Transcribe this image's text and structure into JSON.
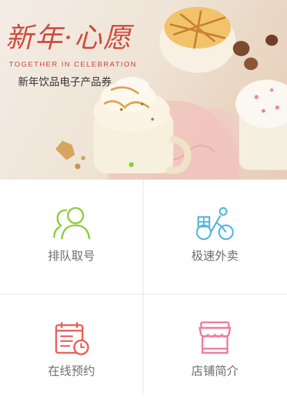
{
  "banner": {
    "title": "新年·心愿",
    "subtitle_en": "TOGETHER IN CELEBRATION",
    "subtitle_cn": "新年饮品电子产品券",
    "slides": 3,
    "active_slide": 1
  },
  "menu": [
    {
      "label": "排队取号",
      "icon": "users-icon",
      "color": "#8dcb3f"
    },
    {
      "label": "极速外卖",
      "icon": "delivery-bike-icon",
      "color": "#55b8dc"
    },
    {
      "label": "在线预约",
      "icon": "calendar-clock-icon",
      "color": "#ec5b55"
    },
    {
      "label": "店铺简介",
      "icon": "storefront-icon",
      "color": "#f07a9a"
    }
  ]
}
